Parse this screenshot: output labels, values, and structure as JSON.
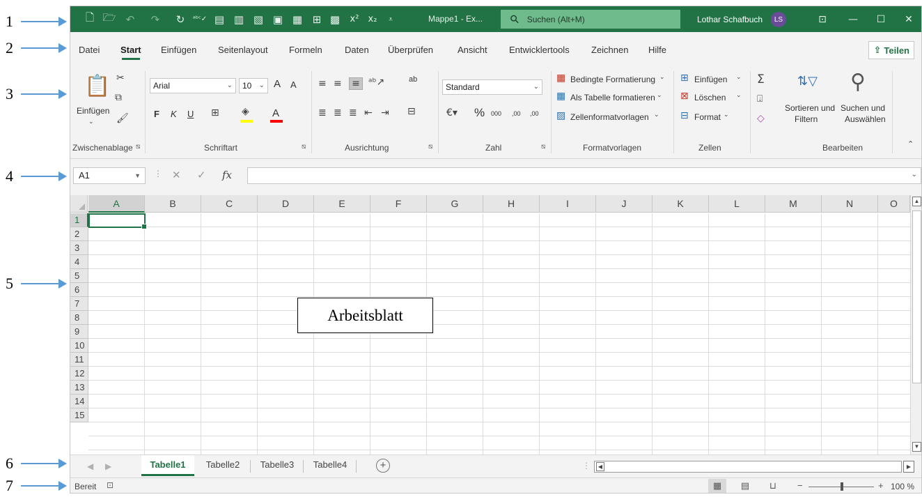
{
  "annotations": [
    "1",
    "2",
    "3",
    "4",
    "5",
    "6",
    "7"
  ],
  "titlebar": {
    "quick_access_icons": [
      "new-file-icon",
      "open-folder-icon",
      "undo-icon",
      "redo-icon",
      "refresh-icon",
      "spelling-icon",
      "print-preview-icon",
      "print-icon",
      "form-icon",
      "save-icon",
      "paste-special-icon",
      "table-icon",
      "grid-icon",
      "superscript-icon",
      "subscript-icon",
      "customize-icon"
    ],
    "superscript_label": "x²",
    "subscript_label": "x₂",
    "document_title": "Mappe1 - Ex...",
    "search_placeholder": "Suchen (Alt+M)",
    "user_name": "Lothar Schafbuch",
    "user_initials": "LS",
    "window_controls": [
      "ribbon-display-icon",
      "minimize-icon",
      "maximize-icon",
      "close-icon"
    ]
  },
  "menu": {
    "tabs": [
      {
        "label": "Datei"
      },
      {
        "label": "Start"
      },
      {
        "label": "Einfügen"
      },
      {
        "label": "Seitenlayout"
      },
      {
        "label": "Formeln"
      },
      {
        "label": "Daten"
      },
      {
        "label": "Überprüfen"
      },
      {
        "label": "Ansicht"
      },
      {
        "label": "Entwicklertools"
      },
      {
        "label": "Zeichnen"
      },
      {
        "label": "Hilfe"
      }
    ],
    "active_tab": "Start",
    "share_label": "Teilen"
  },
  "ribbon": {
    "clipboard": {
      "label": "Zwischenablage",
      "paste_label": "Einfügen"
    },
    "font": {
      "label": "Schriftart",
      "font_name": "Arial",
      "font_size": "10",
      "bold": "F",
      "italic": "K",
      "underline": "U",
      "grow": "A",
      "shrink": "A",
      "fill_color": "#ffff00",
      "font_color": "#ff0000"
    },
    "alignment": {
      "label": "Ausrichtung",
      "wrap_label": "ab"
    },
    "number": {
      "label": "Zahl",
      "format": "Standard",
      "percent": "%",
      "thousands": "000",
      "inc_decimal": ",00",
      "dec_decimal": ",00"
    },
    "styles": {
      "label": "Formatvorlagen",
      "conditional": "Bedingte Formatierung",
      "as_table": "Als Tabelle formatieren",
      "cell_styles": "Zellenformatvorlagen"
    },
    "cells": {
      "label": "Zellen",
      "insert": "Einfügen",
      "delete": "Löschen",
      "format": "Format"
    },
    "editing": {
      "label": "Bearbeiten",
      "sort_line1": "Sortieren und",
      "sort_line2": "Filtern",
      "find_line1": "Suchen und",
      "find_line2": "Auswählen"
    }
  },
  "formula_bar": {
    "name_box": "A1",
    "fx": "fx",
    "formula": ""
  },
  "sheet": {
    "columns": [
      "A",
      "B",
      "C",
      "D",
      "E",
      "F",
      "G",
      "H",
      "I",
      "J",
      "K",
      "L",
      "M",
      "N",
      "O"
    ],
    "rows": [
      "1",
      "2",
      "3",
      "4",
      "5",
      "6",
      "7",
      "8",
      "9",
      "10",
      "11",
      "12",
      "13",
      "14",
      "15"
    ],
    "active_cell": "A1",
    "callout": "Arbeitsblatt"
  },
  "sheet_tabs": {
    "tabs": [
      "Tabelle1",
      "Tabelle2",
      "Tabelle3",
      "Tabelle4"
    ],
    "active": "Tabelle1"
  },
  "statusbar": {
    "status": "Bereit",
    "zoom_minus": "−",
    "zoom_plus": "+",
    "zoom": "100 %",
    "zoom_level_percent": 100
  }
}
